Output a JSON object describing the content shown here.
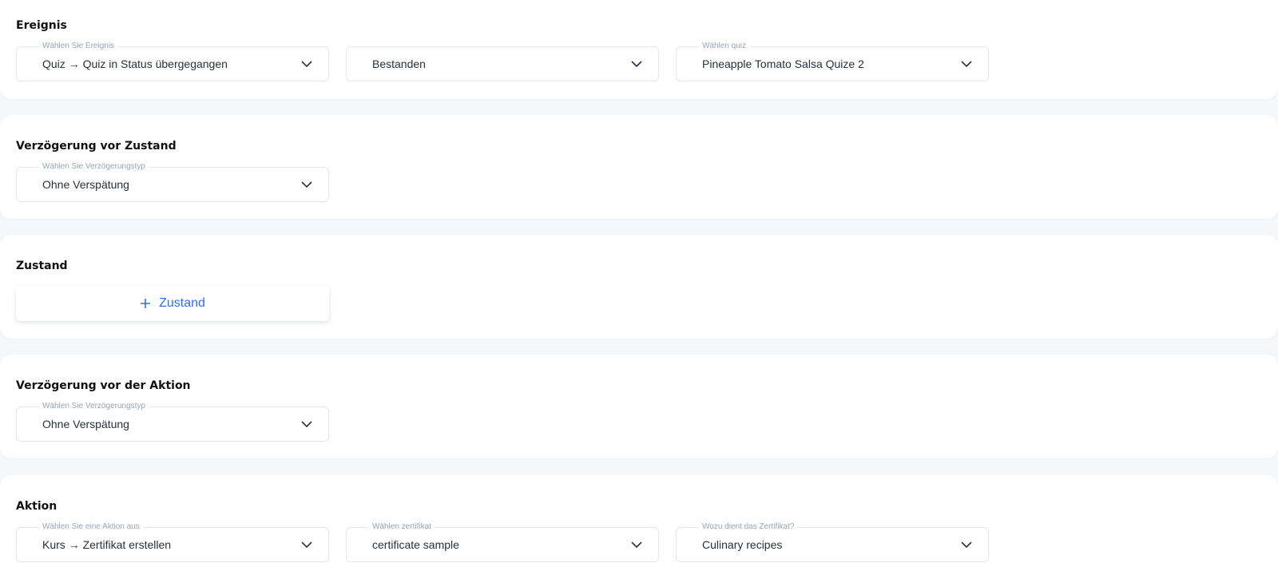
{
  "sections": {
    "event": {
      "title": "Ereignis",
      "fields": [
        {
          "legend": "Wählen Sie Ereignis",
          "value": "Quiz → Quiz in Status übergegangen"
        },
        {
          "legend": "",
          "value": "Bestanden"
        },
        {
          "legend": "Wählen quiz",
          "value": "Pineapple Tomato Salsa Quize 2"
        }
      ]
    },
    "delay_condition": {
      "title": "Verzögerung vor Zustand",
      "fields": [
        {
          "legend": "Wählen Sie Verzögerungstyp",
          "value": "Ohne Verspätung"
        }
      ]
    },
    "condition": {
      "title": "Zustand",
      "add_label": "Zustand"
    },
    "delay_action": {
      "title": "Verzögerung vor der Aktion",
      "fields": [
        {
          "legend": "Wählen Sie Verzögerungstyp",
          "value": "Ohne Verspätung"
        }
      ]
    },
    "action": {
      "title": "Aktion",
      "fields": [
        {
          "legend": "Wählen Sie eine Aktion aus",
          "value": "Kurs → Zertifikat erstellen"
        },
        {
          "legend": "Wählen zertifikat",
          "value": "certificate sample"
        },
        {
          "legend": "Wozu dient das Zertifikat?",
          "value": "Culinary recipes"
        }
      ]
    }
  },
  "icons": {
    "dropdown": "chevron-down-icon",
    "add": "plus-icon"
  },
  "colors": {
    "accent": "#2f6bff",
    "background": "#f6f7fb",
    "legend": "#9aa3b5",
    "border": "#e3e6ee"
  }
}
